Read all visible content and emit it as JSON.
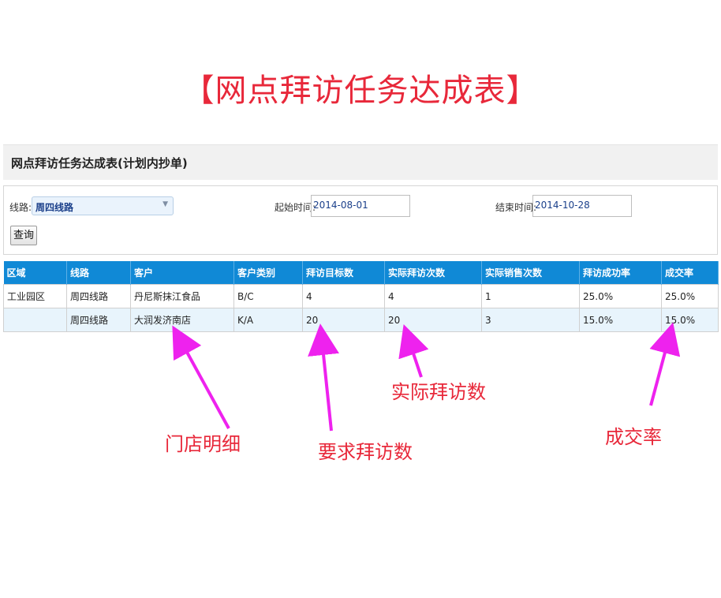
{
  "banner_title": "【网点拜访任务达成表】",
  "panel": {
    "title": "网点拜访任务达成表(计划内抄单)"
  },
  "filters": {
    "route_label": "线路:",
    "route_value": "周四线路",
    "start_label": "起始时间:",
    "start_value": "2014-08-01",
    "end_label": "结束时间:",
    "end_value": "2014-10-28",
    "query_button": "查询"
  },
  "table": {
    "headers": [
      "区域",
      "线路",
      "客户",
      "客户类别",
      "拜访目标数",
      "实际拜访次数",
      "实际销售次数",
      "拜访成功率",
      "成交率"
    ],
    "rows": [
      [
        "工业园区",
        "周四线路",
        "丹尼斯抹江食品",
        "B/C",
        "4",
        "4",
        "1",
        "25.0%",
        "25.0%"
      ],
      [
        "",
        "周四线路",
        "大润发济南店",
        "K/A",
        "20",
        "20",
        "3",
        "15.0%",
        "15.0%"
      ]
    ]
  },
  "annotations": {
    "store_detail": "门店明细",
    "required_visits": "要求拜访数",
    "actual_visits": "实际拜访数",
    "deal_rate": "成交率"
  },
  "colors": {
    "title_red": "#e8283a",
    "header_blue": "#1089d6",
    "arrow_magenta": "#ee22ee",
    "alt_row": "#e8f4fc"
  }
}
